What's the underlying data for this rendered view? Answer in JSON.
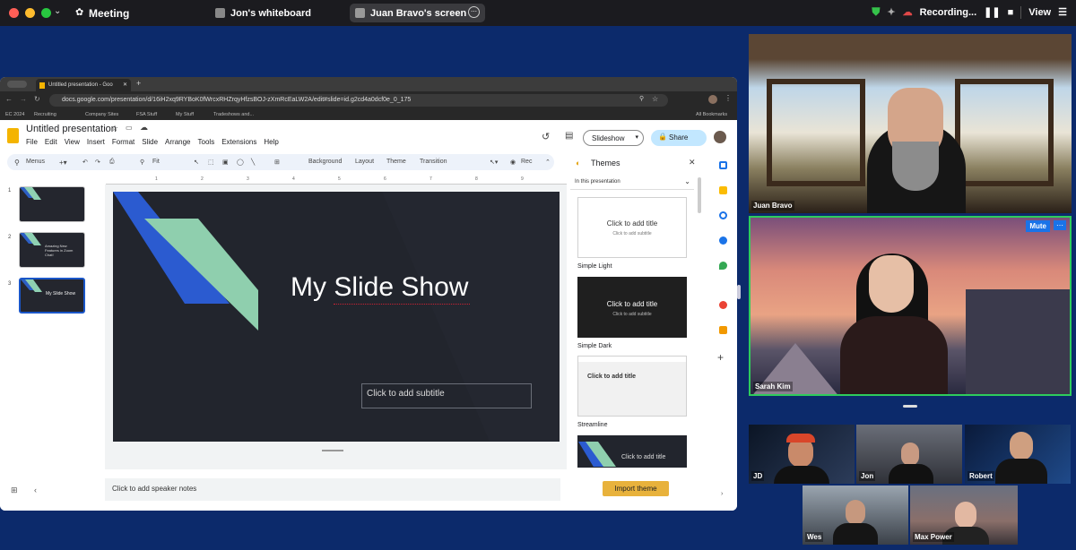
{
  "zoom": {
    "title": "Meeting",
    "whiteboard_tab": "Jon's whiteboard",
    "screen_tab": "Juan Bravo's screen",
    "recording": "Recording...",
    "view": "View"
  },
  "browser": {
    "tab_title": "Untitled presentation - Goo",
    "url": "docs.google.com/presentation/d/16iH2xq9RYBoK0fWrcxRHZrqyHfzsBOJ-zXmRcEaLW2A/edit#slide=id.g2cd4a0dcf0e_0_175",
    "bookmarks": [
      "EC 2024",
      "Recruiting",
      "Company Sites",
      "FSA Stuff",
      "My Stuff",
      "Tradeshows and...",
      "All Bookmarks"
    ]
  },
  "slides_app": {
    "doc_title": "Untitled presentation",
    "menus": [
      "File",
      "Edit",
      "View",
      "Insert",
      "Format",
      "Slide",
      "Arrange",
      "Tools",
      "Extensions",
      "Help"
    ],
    "toolbar": {
      "menus": "Menus",
      "fit": "Fit",
      "background": "Background",
      "layout": "Layout",
      "theme": "Theme",
      "transition": "Transition",
      "rec": "Rec"
    },
    "slideshow": "Slideshow",
    "share": "Share",
    "thumbs": [
      {
        "n": "1",
        "text": ""
      },
      {
        "n": "2",
        "text": "Amazing New Features in Zoom Chat!"
      },
      {
        "n": "3",
        "text": "My Slide Show"
      }
    ],
    "ruler": [
      "1",
      "2",
      "3",
      "4",
      "5",
      "6",
      "7",
      "8",
      "9"
    ],
    "slide_title": "My Slide Show",
    "slide_subtitle": "Click to add subtitle",
    "notes": "Click to add speaker notes",
    "themes": {
      "header": "Themes",
      "section": "In this presentation",
      "items": [
        {
          "name": "Simple Light",
          "title": "Click to add title",
          "subtitle": "Click to add subtitle"
        },
        {
          "name": "Simple Dark",
          "title": "Click to add title",
          "subtitle": "Click to add subtitle"
        },
        {
          "name": "Streamline",
          "title": "Click to add title",
          "subtitle": ""
        },
        {
          "name": "",
          "title": "Click to add title",
          "subtitle": ""
        }
      ],
      "import": "Import theme"
    }
  },
  "participants": {
    "juan": "Juan Bravo",
    "sarah": "Sarah Kim",
    "mute": "Mute",
    "jd": "JD",
    "jon": "Jon",
    "robert": "Robert",
    "wes": "Wes",
    "max": "Max Power"
  }
}
